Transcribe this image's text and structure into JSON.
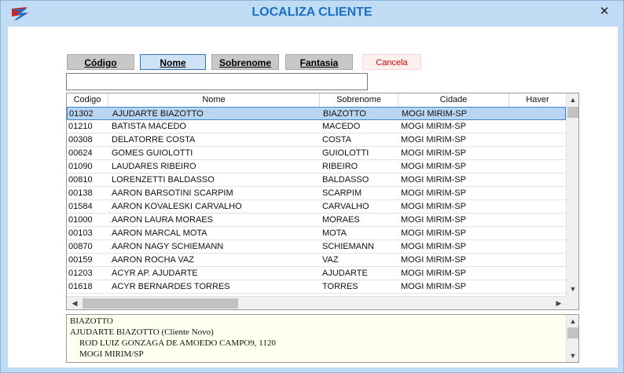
{
  "window": {
    "title": "LOCALIZA CLIENTE",
    "close_glyph": "✕",
    "app_icon": "app-logo-icon"
  },
  "toolbar": {
    "codigo_label": "Código",
    "nome_label": "Nome",
    "sobrenome_label": "Sobrenome",
    "fantasia_label": "Fantasia",
    "cancela_label": "Cancela"
  },
  "search": {
    "value": "",
    "placeholder": ""
  },
  "grid": {
    "columns": [
      "Codigo",
      "Nome",
      "Sobrenome",
      "Cidade",
      "Haver"
    ],
    "rows": [
      {
        "codigo": "01302",
        "nome": "AJUDARTE BIAZOTTO",
        "sobrenome": "BIAZOTTO",
        "cidade": "MOGI MIRIM-SP",
        "haver": "",
        "selected": true
      },
      {
        "codigo": "01210",
        "nome": "BATISTA MACEDO",
        "sobrenome": "MACEDO",
        "cidade": "MOGI MIRIM-SP",
        "haver": ""
      },
      {
        "codigo": "00308",
        "nome": "DELATORRE COSTA",
        "sobrenome": "COSTA",
        "cidade": "MOGI MIRIM-SP",
        "haver": ""
      },
      {
        "codigo": "00624",
        "nome": "GOMES GUIOLOTTI",
        "sobrenome": "GUIOLOTTI",
        "cidade": "MOGI MIRIM-SP",
        "haver": ""
      },
      {
        "codigo": "01090",
        "nome": "LAUDARES RIBEIRO",
        "sobrenome": "RIBEIRO",
        "cidade": "MOGI MIRIM-SP",
        "haver": ""
      },
      {
        "codigo": "00810",
        "nome": "LORENZETTI BALDASSO",
        "sobrenome": "BALDASSO",
        "cidade": "MOGI MIRIM-SP",
        "haver": ""
      },
      {
        "codigo": "00138",
        "nome": "AARON BARSOTINI SCARPIM",
        "sobrenome": "SCARPIM",
        "cidade": "MOGI MIRIM-SP",
        "haver": ""
      },
      {
        "codigo": "01584",
        "nome": "AARON KOVALESKI CARVALHO",
        "sobrenome": "CARVALHO",
        "cidade": "MOGI MIRIM-SP",
        "haver": ""
      },
      {
        "codigo": "01000",
        "nome": "AARON LAURA MORAES",
        "sobrenome": "MORAES",
        "cidade": "MOGI MIRIM-SP",
        "haver": ""
      },
      {
        "codigo": "00103",
        "nome": "AARON MARCAL MOTA",
        "sobrenome": "MOTA",
        "cidade": "MOGI MIRIM-SP",
        "haver": ""
      },
      {
        "codigo": "00870",
        "nome": "AARON NAGY SCHIEMANN",
        "sobrenome": "SCHIEMANN",
        "cidade": "MOGI MIRIM-SP",
        "haver": ""
      },
      {
        "codigo": "00159",
        "nome": "AARON ROCHA VAZ",
        "sobrenome": "VAZ",
        "cidade": "MOGI MIRIM-SP",
        "haver": ""
      },
      {
        "codigo": "01203",
        "nome": "ACYR AP. AJUDARTE",
        "sobrenome": "AJUDARTE",
        "cidade": "MOGI MIRIM-SP",
        "haver": ""
      },
      {
        "codigo": "01618",
        "nome": "ACYR BERNARDES TORRES",
        "sobrenome": "TORRES",
        "cidade": "MOGI MIRIM-SP",
        "haver": ""
      }
    ]
  },
  "info_panel": {
    "lines": [
      "BIAZOTTO",
      "AJUDARTE BIAZOTTO (Cliente Novo)",
      "ROD LUIZ GONZAGA DE AMOEDO CAMPO9, 1120",
      "MOGI MIRIM/SP"
    ]
  },
  "colors": {
    "window_bg": "#bfdcf4",
    "title": "#1b6fc4",
    "selected_row": "#b8d6f1",
    "cancel_text": "#d10000",
    "info_bg": "#fffff0"
  }
}
